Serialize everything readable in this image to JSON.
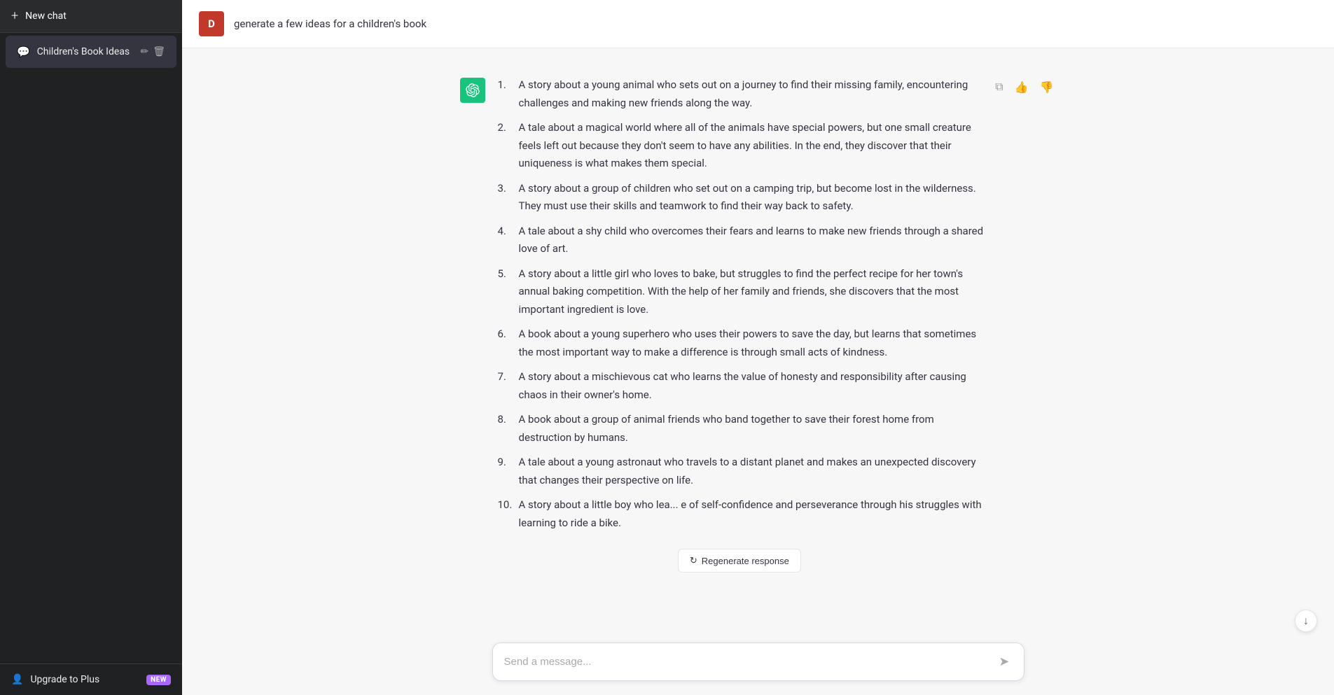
{
  "sidebar": {
    "new_chat_label": "New chat",
    "plus_icon": "+",
    "chat_icon": "💬",
    "chat_item_label": "Children's Book Ideas",
    "edit_icon": "✏",
    "delete_icon": "🗑",
    "upgrade_label": "Upgrade to Plus",
    "upgrade_badge": "NEW",
    "person_icon": "👤"
  },
  "header": {
    "user_initial": "D",
    "user_prompt": "generate a few ideas for a children's book"
  },
  "response": {
    "items": [
      {
        "num": "1.",
        "text": "A story about a young animal who sets out on a journey to find their missing family, encountering challenges and making new friends along the way."
      },
      {
        "num": "2.",
        "text": "A tale about a magical world where all of the animals have special powers, but one small creature feels left out because they don't seem to have any abilities. In the end, they discover that their uniqueness is what makes them special."
      },
      {
        "num": "3.",
        "text": "A story about a group of children who set out on a camping trip, but become lost in the wilderness. They must use their skills and teamwork to find their way back to safety."
      },
      {
        "num": "4.",
        "text": "A tale about a shy child who overcomes their fears and learns to make new friends through a shared love of art."
      },
      {
        "num": "5.",
        "text": "A story about a little girl who loves to bake, but struggles to find the perfect recipe for her town's annual baking competition. With the help of her family and friends, she discovers that the most important ingredient is love."
      },
      {
        "num": "6.",
        "text": "A book about a young superhero who uses their powers to save the day, but learns that sometimes the most important way to make a difference is through small acts of kindness."
      },
      {
        "num": "7.",
        "text": "A story about a mischievous cat who learns the value of honesty and responsibility after causing chaos in their owner's home."
      },
      {
        "num": "8.",
        "text": "A book about a group of animal friends who band together to save their forest home from destruction by humans."
      },
      {
        "num": "9.",
        "text": "A tale about a young astronaut who travels to a distant planet and makes an unexpected discovery that changes their perspective on life."
      },
      {
        "num": "10.",
        "text": "A story about a little boy who lea... e of self-confidence and perseverance through his struggles with learning to ride a bike."
      }
    ],
    "regenerate_label": "Regenerate response",
    "regenerate_icon": "↻"
  },
  "input": {
    "placeholder": "Send a message..."
  },
  "actions": {
    "copy_icon": "⧉",
    "thumbs_up_icon": "👍",
    "thumbs_down_icon": "👎"
  }
}
